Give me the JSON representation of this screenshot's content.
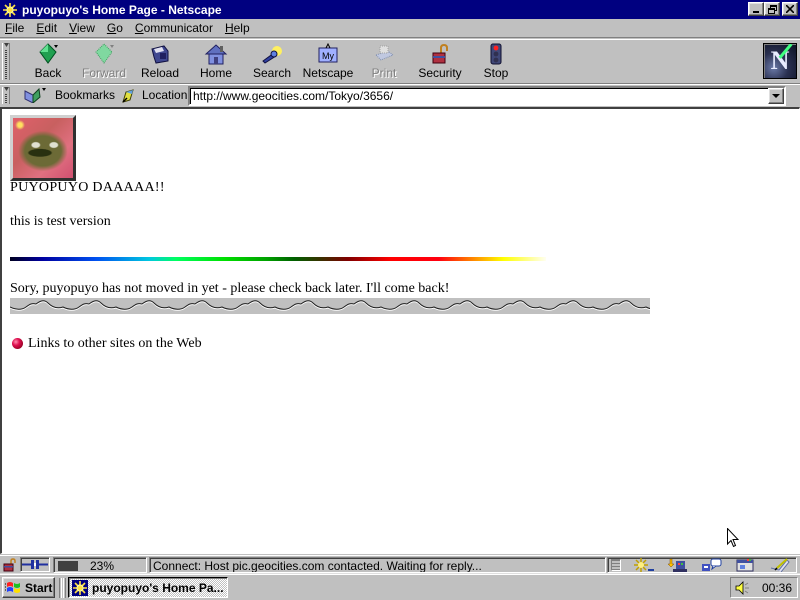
{
  "window": {
    "title": "puyopuyo's Home Page - Netscape",
    "controls": {
      "minimize": "_",
      "restore": "❐",
      "close": "✕"
    }
  },
  "menu": [
    {
      "label": "File",
      "accel": "F"
    },
    {
      "label": "Edit",
      "accel": "E"
    },
    {
      "label": "View",
      "accel": "V"
    },
    {
      "label": "Go",
      "accel": "G"
    },
    {
      "label": "Communicator",
      "accel": "C"
    },
    {
      "label": "Help",
      "accel": "H"
    }
  ],
  "toolbar": {
    "buttons": [
      {
        "label": "Back",
        "icon": "back-arrow-icon",
        "enabled": true
      },
      {
        "label": "Forward",
        "icon": "forward-arrow-icon",
        "enabled": false
      },
      {
        "label": "Reload",
        "icon": "reload-icon",
        "enabled": true
      },
      {
        "label": "Home",
        "icon": "home-icon",
        "enabled": true
      },
      {
        "label": "Search",
        "icon": "search-icon",
        "enabled": true
      },
      {
        "label": "Netscape",
        "icon": "my-netscape-icon",
        "enabled": true
      },
      {
        "label": "Print",
        "icon": "print-icon",
        "enabled": false
      },
      {
        "label": "Security",
        "icon": "security-lock-icon",
        "enabled": true
      },
      {
        "label": "Stop",
        "icon": "stop-icon",
        "enabled": true
      }
    ],
    "logo": "N"
  },
  "location_bar": {
    "bookmarks_label": "Bookmarks",
    "location_label": "Location:",
    "url": "http://www.geocities.com/Tokyo/3656/"
  },
  "page": {
    "heading": "PUYOPUYO DAAAAA!!",
    "subtext": "this is test version",
    "notice": "Sory, puyopuyo has not moved in yet - please check back later.  I'll come back!",
    "link": "Links to other sites on the Web"
  },
  "status_bar": {
    "progress_percent": 23,
    "progress_label": "23%",
    "message": "Connect: Host pic.geocities.com contacted. Waiting for reply..."
  },
  "taskbar": {
    "start_label": "Start",
    "task_label": "puyopuyo's Home Pa...",
    "clock": "00:36"
  }
}
